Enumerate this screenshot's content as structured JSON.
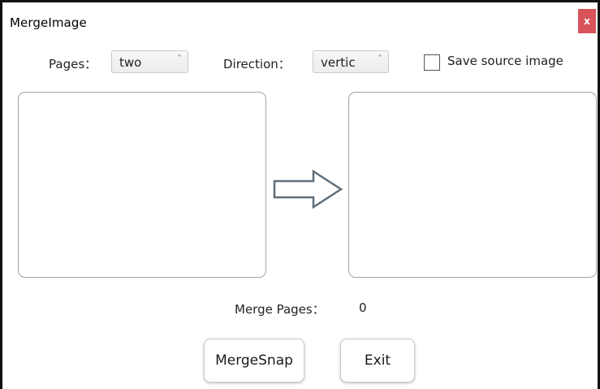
{
  "window": {
    "title": "MergeImage",
    "close_label": "x"
  },
  "options": {
    "pages_label": "Pages：",
    "pages_value": "two",
    "direction_label": "Direction：",
    "direction_value": "vertic",
    "save_source_label": "Save source image",
    "save_source_checked": false
  },
  "status": {
    "merge_pages_label": "Merge Pages：",
    "merge_pages_value": "0"
  },
  "buttons": {
    "merge_label": "MergeSnap",
    "exit_label": "Exit"
  },
  "icons": {
    "dropdown": "chevron-down-icon",
    "arrow": "right-arrow-icon"
  },
  "colors": {
    "close_button": "#d9535a",
    "panel_border": "#9aa4ad",
    "arrow_stroke": "#5f6e7a"
  }
}
